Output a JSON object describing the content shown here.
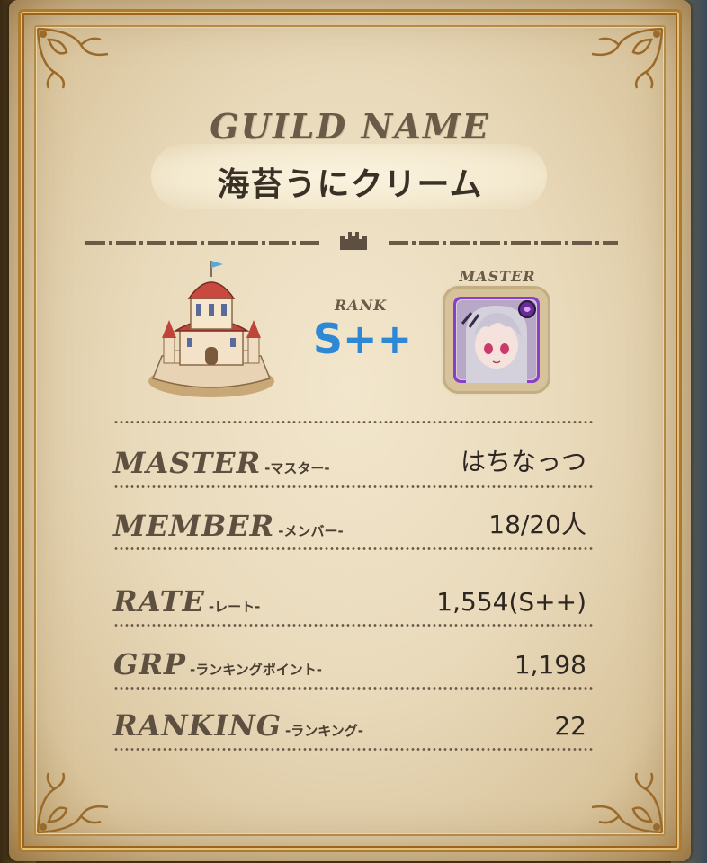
{
  "guild": {
    "label": "GUILD NAME",
    "name": "海苔うにクリーム"
  },
  "rank": {
    "label": "RANK",
    "value": "S++"
  },
  "master_avatar": {
    "label": "MASTER"
  },
  "info_rows": [
    {
      "label": "MASTER",
      "sub": "-マスター-",
      "value": "はちなっつ"
    },
    {
      "label": "MEMBER",
      "sub": "-メンバー-",
      "value": "18/20人"
    },
    {
      "label": "RATE",
      "sub": "-レート-",
      "value": "1,554(S++)"
    },
    {
      "label": "GRP",
      "sub": "-ランキングポイント-",
      "value": "1,198"
    },
    {
      "label": "RANKING",
      "sub": "-ランキング-",
      "value": "22"
    }
  ],
  "colors": {
    "parchment": "#e9dabb",
    "frame_gold": "#b07a2c",
    "rank_blue": "#2f88d6",
    "avatar_border": "#8a3fc8"
  },
  "icons": [
    "castle-icon",
    "guild-castle-icon",
    "master-avatar",
    "dark-element-icon"
  ]
}
